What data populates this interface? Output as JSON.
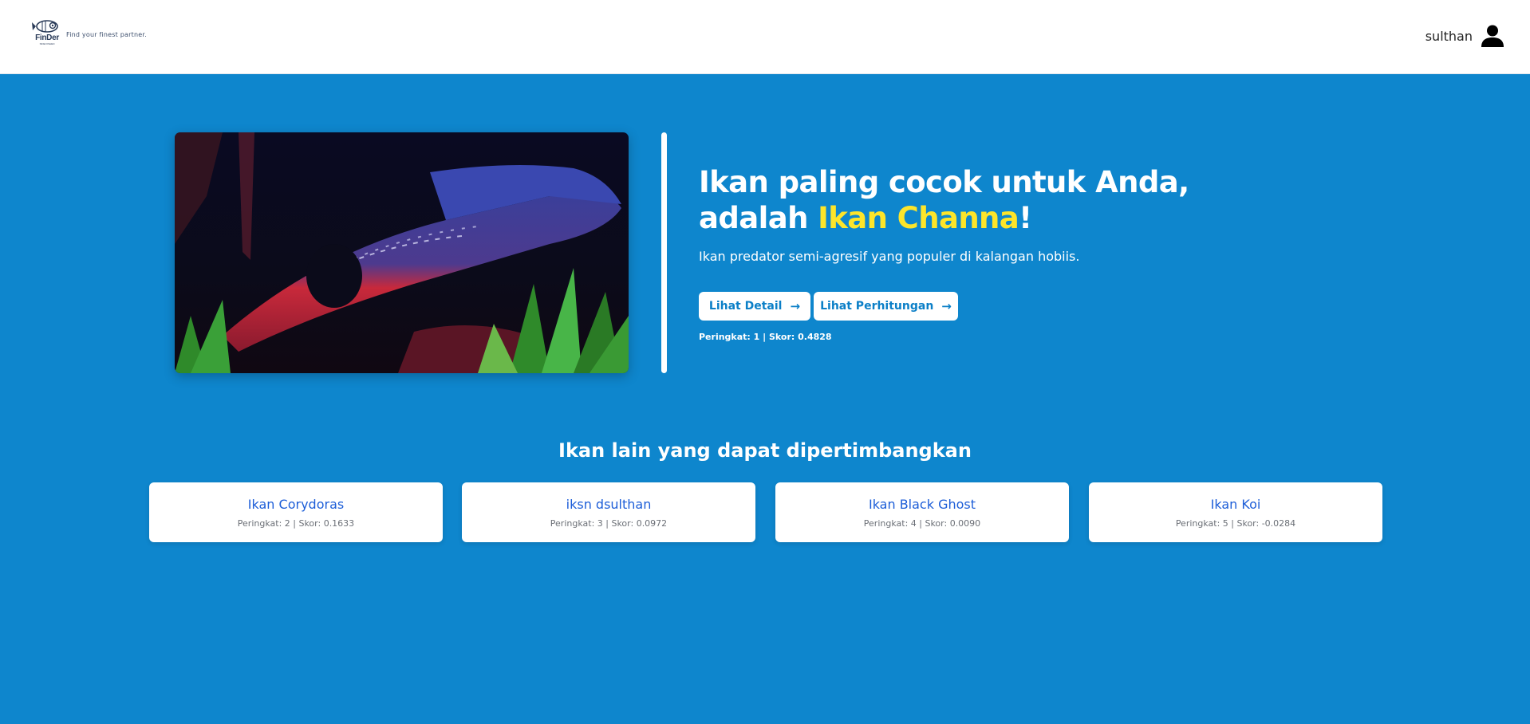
{
  "header": {
    "logo_text": "FinDer",
    "logo_subtext": "SINE FISHEN",
    "tagline": "Find your finest partner.",
    "username": "sulthan",
    "avatar_icon": "user-icon"
  },
  "hero": {
    "image_alt": "Ikan Channa",
    "headline_prefix": "Ikan paling cocok untuk Anda, adalah ",
    "fish_name": "Ikan Channa",
    "headline_suffix": "!",
    "description": "Ikan predator semi-agresif yang populer di kalangan hobiis.",
    "detail_button": "Lihat Detail",
    "calc_button": "Lihat Perhitungan",
    "rank_text": "Peringkat: 1 | Skor: 0.4828",
    "highlight_color": "#fde52a"
  },
  "others": {
    "title": "Ikan lain yang dapat dipertimbangkan",
    "items": [
      {
        "name": "Ikan Corydoras",
        "meta": "Peringkat: 2 | Skor: 0.1633"
      },
      {
        "name": "iksn dsulthan",
        "meta": "Peringkat: 3 | Skor: 0.0972"
      },
      {
        "name": "Ikan Black Ghost",
        "meta": "Peringkat: 4 | Skor: 0.0090"
      },
      {
        "name": "Ikan Koi",
        "meta": "Peringkat: 5 | Skor: -0.0284"
      }
    ]
  },
  "colors": {
    "background": "#0e86cd",
    "accent_text": "#1d5ed8"
  }
}
